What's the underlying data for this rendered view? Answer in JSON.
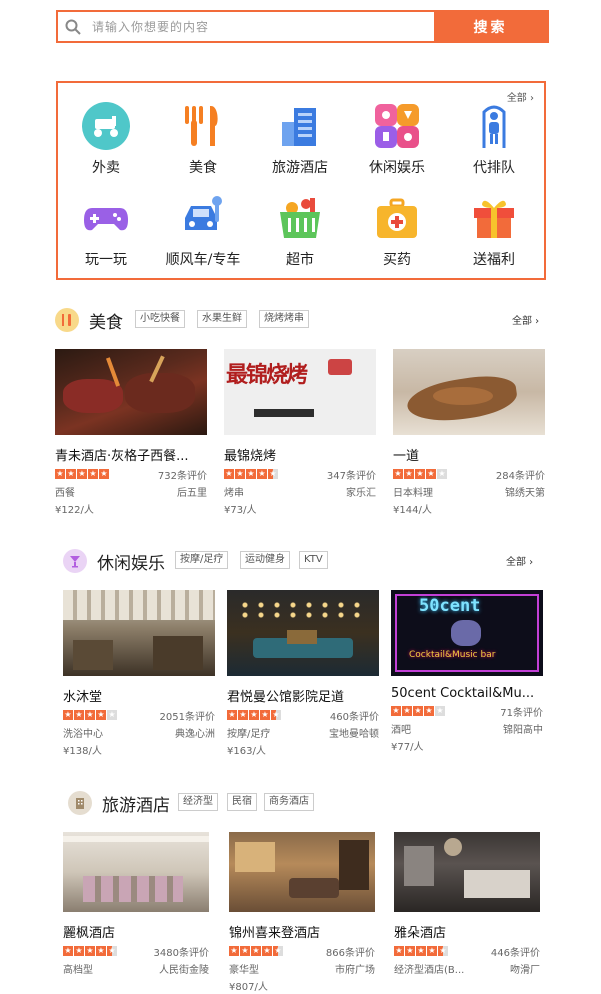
{
  "search": {
    "placeholder": "请输入你想要的内容",
    "button": "搜索"
  },
  "categories": {
    "all_label": "全部 ›",
    "items": [
      {
        "label": "外卖",
        "icon": "scooter-icon"
      },
      {
        "label": "美食",
        "icon": "fork-knife-icon"
      },
      {
        "label": "旅游酒店",
        "icon": "building-icon"
      },
      {
        "label": "休闲娱乐",
        "icon": "entertainment-icon"
      },
      {
        "label": "代排队",
        "icon": "person-queue-icon"
      },
      {
        "label": "玩一玩",
        "icon": "gamepad-icon"
      },
      {
        "label": "顺风车/专车",
        "icon": "car-icon"
      },
      {
        "label": "超市",
        "icon": "basket-icon"
      },
      {
        "label": "买药",
        "icon": "medicine-box-icon"
      },
      {
        "label": "送福利",
        "icon": "gift-icon"
      }
    ]
  },
  "food": {
    "title": "美食",
    "tags": [
      "小吃快餐",
      "水果生鲜",
      "烧烤烤串"
    ],
    "more": "全部 ›",
    "cards": [
      {
        "name": "青未酒店·灰格子西餐...",
        "rating": 5,
        "reviews": "732条评价",
        "type": "西餐",
        "area": "后五里",
        "price": "¥122/人"
      },
      {
        "name": "最锦烧烤",
        "rating": 4.5,
        "reviews": "347条评价",
        "type": "烤串",
        "area": "家乐汇",
        "price": "¥73/人",
        "banner": "最锦烧烤"
      },
      {
        "name": "一道",
        "rating": 4,
        "reviews": "284条评价",
        "type": "日本料理",
        "area": "锦绣天第",
        "price": "¥144/人"
      }
    ]
  },
  "leisure": {
    "title": "休闲娱乐",
    "tags": [
      "按摩/足疗",
      "运动健身",
      "KTV"
    ],
    "more": "全部 ›",
    "cards": [
      {
        "name": "水沐堂",
        "rating": 4,
        "reviews": "2051条评价",
        "type": "洗浴中心",
        "area": "典逸心洲",
        "price": "¥138/人"
      },
      {
        "name": "君悦曼公馆影院足道",
        "rating": 4.5,
        "reviews": "460条评价",
        "type": "按摩/足疗",
        "area": "宝地曼哈顿",
        "price": "¥163/人"
      },
      {
        "name": "50cent Cocktail&Mu...",
        "rating": 4,
        "reviews": "71条评价",
        "type": "酒吧",
        "area": "锦阳高中",
        "price": "¥77/人",
        "neon": "50cent",
        "sub": "Cocktail&Music bar"
      }
    ]
  },
  "hotel": {
    "title": "旅游酒店",
    "tags": [
      "经济型",
      "民宿",
      "商务酒店"
    ],
    "cards": [
      {
        "name": "麗枫酒店",
        "rating": 4.5,
        "reviews": "3480条评价",
        "type": "高档型",
        "area": "人民街金陵",
        "price": ""
      },
      {
        "name": "锦州喜来登酒店",
        "rating": 4.5,
        "reviews": "866条评价",
        "type": "豪华型",
        "area": "市府广场",
        "price": "¥807/人"
      },
      {
        "name": "雅朵酒店",
        "rating": 4.5,
        "reviews": "446条评价",
        "type": "经济型酒店(B...",
        "area": "吻滑厂",
        "price": ""
      }
    ]
  },
  "colors": {
    "accent": "#f26b3a"
  }
}
